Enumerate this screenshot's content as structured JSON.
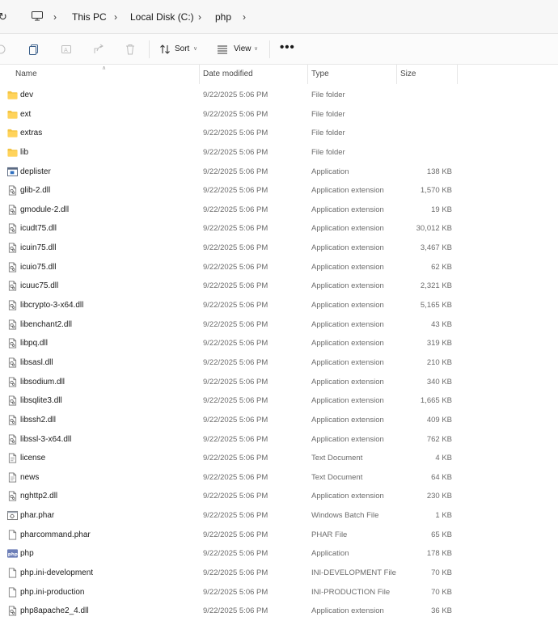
{
  "address": {
    "crumbs": [
      "This PC",
      "Local Disk (C:)",
      "php"
    ]
  },
  "toolbar": {
    "sort_label": "Sort",
    "view_label": "View",
    "more_label": "•••"
  },
  "columns": {
    "name": "Name",
    "date": "Date modified",
    "type": "Type",
    "size": "Size"
  },
  "files": [
    {
      "name": "dev",
      "date": "9/22/2025 5:06 PM",
      "type": "File folder",
      "size": "",
      "icon": "folder-icon"
    },
    {
      "name": "ext",
      "date": "9/22/2025 5:06 PM",
      "type": "File folder",
      "size": "",
      "icon": "folder-icon"
    },
    {
      "name": "extras",
      "date": "9/22/2025 5:06 PM",
      "type": "File folder",
      "size": "",
      "icon": "folder-icon"
    },
    {
      "name": "lib",
      "date": "9/22/2025 5:06 PM",
      "type": "File folder",
      "size": "",
      "icon": "folder-icon"
    },
    {
      "name": "deplister",
      "date": "9/22/2025 5:06 PM",
      "type": "Application",
      "size": "138 KB",
      "icon": "application-icon"
    },
    {
      "name": "glib-2.dll",
      "date": "9/22/2025 5:06 PM",
      "type": "Application extension",
      "size": "1,570 KB",
      "icon": "dll-icon"
    },
    {
      "name": "gmodule-2.dll",
      "date": "9/22/2025 5:06 PM",
      "type": "Application extension",
      "size": "19 KB",
      "icon": "dll-icon"
    },
    {
      "name": "icudt75.dll",
      "date": "9/22/2025 5:06 PM",
      "type": "Application extension",
      "size": "30,012 KB",
      "icon": "dll-icon"
    },
    {
      "name": "icuin75.dll",
      "date": "9/22/2025 5:06 PM",
      "type": "Application extension",
      "size": "3,467 KB",
      "icon": "dll-icon"
    },
    {
      "name": "icuio75.dll",
      "date": "9/22/2025 5:06 PM",
      "type": "Application extension",
      "size": "62 KB",
      "icon": "dll-icon"
    },
    {
      "name": "icuuc75.dll",
      "date": "9/22/2025 5:06 PM",
      "type": "Application extension",
      "size": "2,321 KB",
      "icon": "dll-icon"
    },
    {
      "name": "libcrypto-3-x64.dll",
      "date": "9/22/2025 5:06 PM",
      "type": "Application extension",
      "size": "5,165 KB",
      "icon": "dll-icon"
    },
    {
      "name": "libenchant2.dll",
      "date": "9/22/2025 5:06 PM",
      "type": "Application extension",
      "size": "43 KB",
      "icon": "dll-icon"
    },
    {
      "name": "libpq.dll",
      "date": "9/22/2025 5:06 PM",
      "type": "Application extension",
      "size": "319 KB",
      "icon": "dll-icon"
    },
    {
      "name": "libsasl.dll",
      "date": "9/22/2025 5:06 PM",
      "type": "Application extension",
      "size": "210 KB",
      "icon": "dll-icon"
    },
    {
      "name": "libsodium.dll",
      "date": "9/22/2025 5:06 PM",
      "type": "Application extension",
      "size": "340 KB",
      "icon": "dll-icon"
    },
    {
      "name": "libsqlite3.dll",
      "date": "9/22/2025 5:06 PM",
      "type": "Application extension",
      "size": "1,665 KB",
      "icon": "dll-icon"
    },
    {
      "name": "libssh2.dll",
      "date": "9/22/2025 5:06 PM",
      "type": "Application extension",
      "size": "409 KB",
      "icon": "dll-icon"
    },
    {
      "name": "libssl-3-x64.dll",
      "date": "9/22/2025 5:06 PM",
      "type": "Application extension",
      "size": "762 KB",
      "icon": "dll-icon"
    },
    {
      "name": "license",
      "date": "9/22/2025 5:06 PM",
      "type": "Text Document",
      "size": "4 KB",
      "icon": "text-document-icon"
    },
    {
      "name": "news",
      "date": "9/22/2025 5:06 PM",
      "type": "Text Document",
      "size": "64 KB",
      "icon": "text-document-icon"
    },
    {
      "name": "nghttp2.dll",
      "date": "9/22/2025 5:06 PM",
      "type": "Application extension",
      "size": "230 KB",
      "icon": "dll-icon"
    },
    {
      "name": "phar.phar",
      "date": "9/22/2025 5:06 PM",
      "type": "Windows Batch File",
      "size": "1 KB",
      "icon": "batch-file-icon"
    },
    {
      "name": "pharcommand.phar",
      "date": "9/22/2025 5:06 PM",
      "type": "PHAR File",
      "size": "65 KB",
      "icon": "blank-file-icon"
    },
    {
      "name": "php",
      "date": "9/22/2025 5:06 PM",
      "type": "Application",
      "size": "178 KB",
      "icon": "php-icon"
    },
    {
      "name": "php.ini-development",
      "date": "9/22/2025 5:06 PM",
      "type": "INI-DEVELOPMENT File",
      "size": "70 KB",
      "icon": "blank-file-icon"
    },
    {
      "name": "php.ini-production",
      "date": "9/22/2025 5:06 PM",
      "type": "INI-PRODUCTION File",
      "size": "70 KB",
      "icon": "blank-file-icon"
    },
    {
      "name": "php8apache2_4.dll",
      "date": "9/22/2025 5:06 PM",
      "type": "Application extension",
      "size": "36 KB",
      "icon": "dll-icon"
    }
  ]
}
